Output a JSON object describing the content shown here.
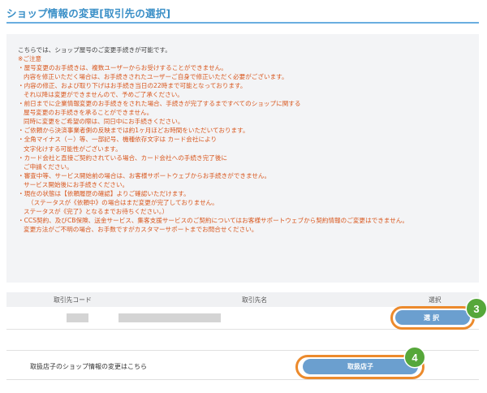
{
  "page": {
    "title": "ショップ情報の変更[取引先の選択]"
  },
  "notice": {
    "intro": "こちらでは、ショップ屋号のご変更手続きが可能です。",
    "caution_heading": "※ご注意",
    "lines": [
      {
        "text": "・屋号変更のお手続きは、複数ユーザーからお受けすることができません。",
        "indent": 0
      },
      {
        "text": "内容を修正いただく場合は、お手続きされたユーザーご自身で修正いただく必要がございます。",
        "indent": 1
      },
      {
        "text": "・内容の修正、および取り下げはお手続き当日の22時まで可能となっております。",
        "indent": 0
      },
      {
        "text": "それ以降は変更ができませんので、予めご了承ください。",
        "indent": 1
      },
      {
        "text": "・前日までに企業情報変更のお手続きをされた場合、手続きが完了するまですべてのショップに関する",
        "indent": 0
      },
      {
        "text": "屋号変更のお手続きを承ることができません。",
        "indent": 1
      },
      {
        "text": "同時に変更をご希望の際は、同日中にお手続きください。",
        "indent": 1
      },
      {
        "text": "・ご依頼から決済事業者側の反映までは約1ヶ月ほどお時間をいただいております。",
        "indent": 0
      },
      {
        "text": "・全角マイナス（－）等、一部記号、機種依存文字は カード会社により",
        "indent": 0
      },
      {
        "text": "文字化けする可能性がございます。",
        "indent": 1
      },
      {
        "text": "・カード会社と直接ご契約されている場合、カード会社への手続き完了後に",
        "indent": 0
      },
      {
        "text": "ご申請ください。",
        "indent": 1
      },
      {
        "text": "・審査中等、サービス開始前の場合は、お客様サポートウェブからお手続きができません。",
        "indent": 0
      },
      {
        "text": "サービス開始後にお手続きください。",
        "indent": 1
      },
      {
        "text": "・現在の状態は【依頼履歴の確認】よりご確認いただけます。",
        "indent": 0
      },
      {
        "text": "（ステータスが《依頼中》の場合はまだ変更が完了しておりません。",
        "indent": 2
      },
      {
        "text": "ステータスが《完了》となるまでお待ちください。）",
        "indent": 1
      },
      {
        "text": "・CCS契約、及びCB保険、送金サービス、集客支援サービスのご契約についてはお客様サポートウェブから契約情報のご変更はできません。",
        "indent": 0
      },
      {
        "text": "変更方法がご不明の場合、お手数ですがカスタマーサポートまでお問合せください。",
        "indent": 1
      }
    ]
  },
  "table": {
    "headers": {
      "code": "取引先コード",
      "name": "取引先名",
      "select": "選択"
    },
    "row": {
      "select_button": "選択"
    }
  },
  "store": {
    "label": "取扱店子のショップ情報の変更はこちら",
    "button": "取扱店子"
  },
  "badges": {
    "step3": "3",
    "step4": "4"
  },
  "colors": {
    "accent": "#3a8fc7",
    "button": "#6b9fcf",
    "highlight_ring": "#ec8a2c",
    "badge": "#56a73a",
    "warning_text": "#d9581f"
  }
}
